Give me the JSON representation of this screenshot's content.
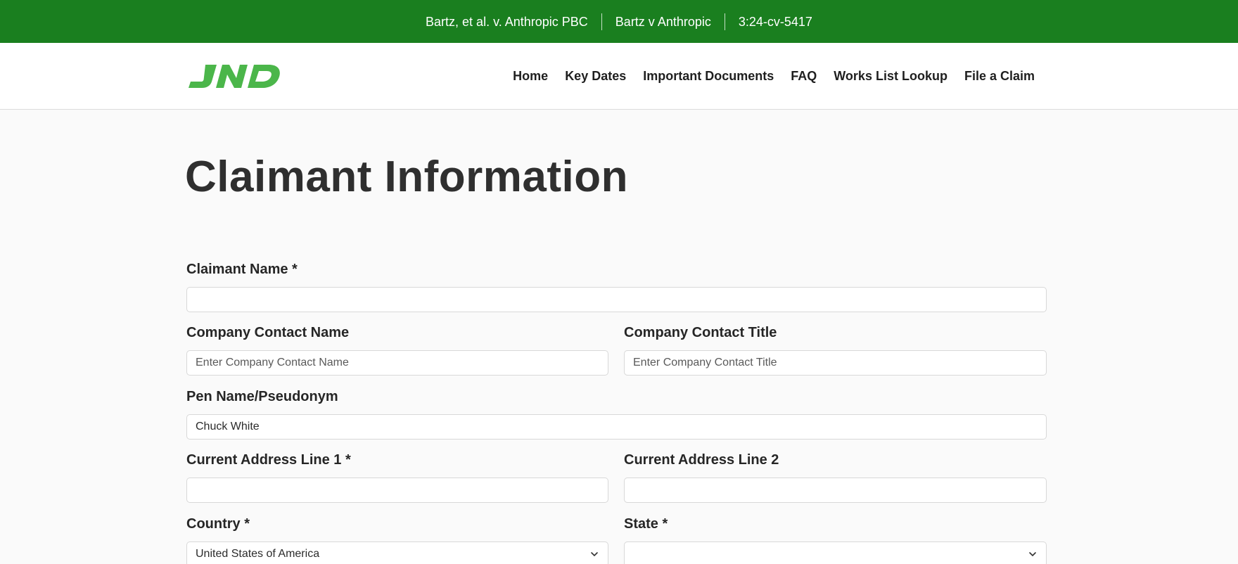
{
  "topbar": {
    "case_name": "Bartz, et al. v. Anthropic PBC",
    "short_name": "Bartz v Anthropic",
    "case_number": "3:24-cv-5417",
    "background_color": "#1a7f1f"
  },
  "header": {
    "logo_text": "JND",
    "logo_color": "#4bb64a",
    "nav": [
      {
        "label": "Home"
      },
      {
        "label": "Key Dates"
      },
      {
        "label": "Important Documents"
      },
      {
        "label": "FAQ"
      },
      {
        "label": "Works List Lookup"
      },
      {
        "label": "File a Claim"
      }
    ]
  },
  "main": {
    "title": "Claimant Information",
    "fields": {
      "claimant_name": {
        "label": "Claimant Name *",
        "value": "",
        "placeholder": ""
      },
      "company_contact_name": {
        "label": "Company Contact Name",
        "value": "",
        "placeholder": "Enter Company Contact Name"
      },
      "company_contact_title": {
        "label": "Company Contact Title",
        "value": "",
        "placeholder": "Enter Company Contact Title"
      },
      "pen_name": {
        "label": "Pen Name/Pseudonym",
        "value": "Chuck White",
        "placeholder": ""
      },
      "address_line_1": {
        "label": "Current Address Line 1 *",
        "value": "",
        "placeholder": ""
      },
      "address_line_2": {
        "label": "Current Address Line 2",
        "value": "",
        "placeholder": ""
      },
      "country": {
        "label": "Country *",
        "selected": "United States of America",
        "icon": "chevron-down-icon"
      },
      "state": {
        "label": "State *",
        "selected": "",
        "icon": "chevron-down-icon"
      }
    }
  }
}
